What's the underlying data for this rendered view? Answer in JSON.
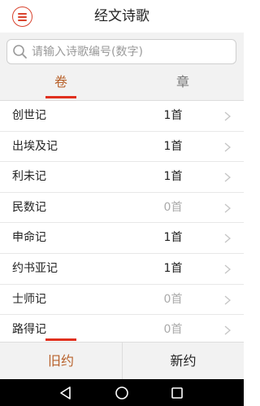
{
  "header": {
    "title": "经文诗歌",
    "menu_icon": "hamburger-menu-icon",
    "accent": "#d9442f"
  },
  "search": {
    "placeholder": "请输入诗歌编号(数字)",
    "icon": "search-icon"
  },
  "tabs": {
    "left": "卷",
    "right": "章",
    "active": "left",
    "active_color": "#b8612b"
  },
  "books": [
    {
      "name": "创世记",
      "count": "1首"
    },
    {
      "name": "出埃及记",
      "count": "1首"
    },
    {
      "name": "利未记",
      "count": "1首"
    },
    {
      "name": "民数记",
      "count": "0首"
    },
    {
      "name": "申命记",
      "count": "1首"
    },
    {
      "name": "约书亚记",
      "count": "1首"
    },
    {
      "name": "士师记",
      "count": "0首"
    },
    {
      "name": "路得记",
      "count": "0首"
    }
  ],
  "bottom_tabs": {
    "old": "旧约",
    "new": "新约",
    "active": "old"
  },
  "navbar": {
    "icons": [
      "back-icon",
      "home-icon",
      "recents-icon"
    ]
  }
}
